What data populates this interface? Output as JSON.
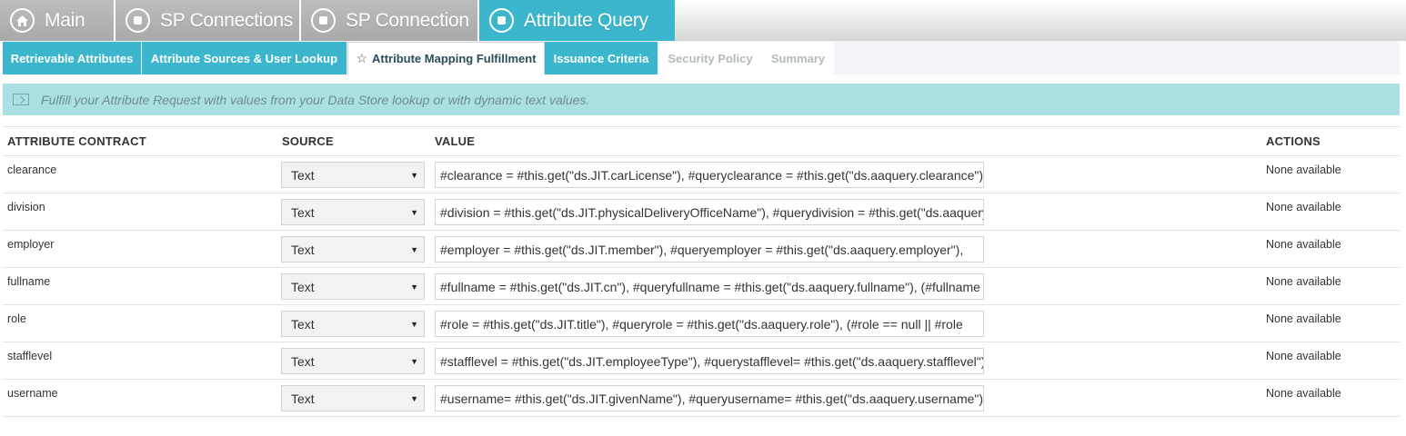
{
  "top_tabs": [
    {
      "label": "Main",
      "icon": "home-icon",
      "state": "gray"
    },
    {
      "label": "SP Connections",
      "icon": "square-icon",
      "state": "gray"
    },
    {
      "label": "SP Connection",
      "icon": "square-icon",
      "state": "gray"
    },
    {
      "label": "Attribute Query",
      "icon": "square-icon",
      "state": "active"
    }
  ],
  "sub_tabs": [
    {
      "label": "Retrievable Attributes",
      "state": "teal"
    },
    {
      "label": "Attribute Sources & User Lookup",
      "state": "teal"
    },
    {
      "label": "Attribute Mapping Fulfillment",
      "state": "current"
    },
    {
      "label": "Issuance Criteria",
      "state": "teal"
    },
    {
      "label": "Security Policy",
      "state": "disabled"
    },
    {
      "label": "Summary",
      "state": "disabled"
    }
  ],
  "banner": {
    "text": "Fulfill your Attribute Request with values from your Data Store lookup or with dynamic text values."
  },
  "table": {
    "headers": {
      "attribute_contract": "ATTRIBUTE CONTRACT",
      "source": "SOURCE",
      "value": "VALUE",
      "actions": "ACTIONS"
    },
    "rows": [
      {
        "name": "clearance",
        "source": "Text",
        "value": "#clearance = #this.get(\"ds.JIT.carLicense\"), #queryclearance = #this.get(\"ds.aaquery.clearance\")",
        "actions": "None available"
      },
      {
        "name": "division",
        "source": "Text",
        "value": "#division = #this.get(\"ds.JIT.physicalDeliveryOfficeName\"), #querydivision = #this.get(\"ds.aaquery.division\")",
        "actions": "None available"
      },
      {
        "name": "employer",
        "source": "Text",
        "value": "#employer = #this.get(\"ds.JIT.member\"), #queryemployer = #this.get(\"ds.aaquery.employer\"),",
        "actions": "None available"
      },
      {
        "name": "fullname",
        "source": "Text",
        "value": "#fullname = #this.get(\"ds.JIT.cn\"), #queryfullname = #this.get(\"ds.aaquery.fullname\"), (#fullname",
        "actions": "None available"
      },
      {
        "name": "role",
        "source": "Text",
        "value": "#role = #this.get(\"ds.JIT.title\"), #queryrole = #this.get(\"ds.aaquery.role\"), (#role == null || #role",
        "actions": "None available"
      },
      {
        "name": "stafflevel",
        "source": "Text",
        "value": "#stafflevel = #this.get(\"ds.JIT.employeeType\"), #querystafflevel= #this.get(\"ds.aaquery.stafflevel\")",
        "actions": "None available"
      },
      {
        "name": "username",
        "source": "Text",
        "value": "#username= #this.get(\"ds.JIT.givenName\"), #queryusername= #this.get(\"ds.aaquery.username\")",
        "actions": "None available"
      }
    ]
  },
  "colors": {
    "accent": "#3bb6cc",
    "banner_bg": "#abe0e3",
    "tab_gray": "#b3b3b3"
  }
}
